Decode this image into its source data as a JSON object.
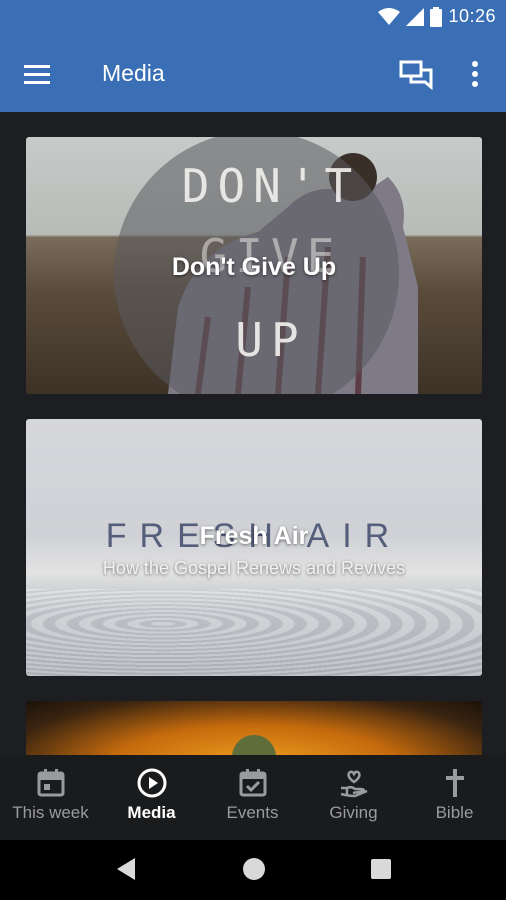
{
  "status_bar": {
    "time": "10:26",
    "icons": [
      "wifi-icon",
      "signal-icon",
      "battery-icon"
    ]
  },
  "app_bar": {
    "title": "Media",
    "icons": [
      "menu-icon",
      "chat-icon",
      "more-vert-icon"
    ],
    "color": "#3a6fb5"
  },
  "cards": [
    {
      "title": "Don't Give Up",
      "artwork_text": [
        "DON'T",
        "GIVE",
        "UP"
      ]
    },
    {
      "title": "Fresh Air",
      "subtitle": "How the Gospel Renews and Revives",
      "artwork_text": "FRESH AIR"
    },
    {
      "title": ""
    }
  ],
  "bottom_nav": {
    "items": [
      {
        "label": "This week",
        "icon": "calendar-icon",
        "active": false
      },
      {
        "label": "Media",
        "icon": "play-circle-icon",
        "active": true
      },
      {
        "label": "Events",
        "icon": "event-check-icon",
        "active": false
      },
      {
        "label": "Giving",
        "icon": "giving-hand-icon",
        "active": false
      },
      {
        "label": "Bible",
        "icon": "cross-icon",
        "active": false
      }
    ]
  },
  "system_nav": [
    "back-icon",
    "home-icon",
    "recents-icon"
  ]
}
